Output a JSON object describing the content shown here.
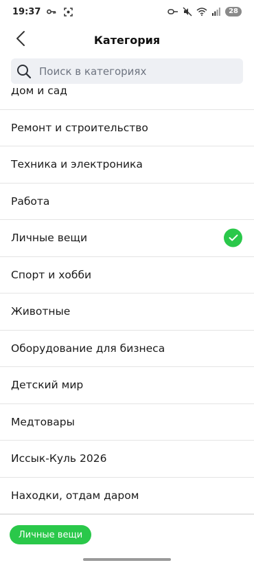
{
  "status_bar": {
    "time": "19:37",
    "battery": "28"
  },
  "header": {
    "title": "Категория"
  },
  "search": {
    "placeholder": "Поиск в категориях",
    "value": ""
  },
  "categories": [
    {
      "label": "Дом и сад",
      "selected": false
    },
    {
      "label": "Ремонт и строительство",
      "selected": false
    },
    {
      "label": "Техника и электроника",
      "selected": false
    },
    {
      "label": "Работа",
      "selected": false
    },
    {
      "label": "Личные вещи",
      "selected": true
    },
    {
      "label": "Спорт и хобби",
      "selected": false
    },
    {
      "label": "Животные",
      "selected": false
    },
    {
      "label": "Оборудование для бизнеса",
      "selected": false
    },
    {
      "label": "Детский мир",
      "selected": false
    },
    {
      "label": "Медтовары",
      "selected": false
    },
    {
      "label": "Иссык-Куль 2026",
      "selected": false
    },
    {
      "label": "Находки, отдам даром",
      "selected": false
    }
  ],
  "selected_chip": {
    "label": "Личные вещи"
  },
  "colors": {
    "accent": "#2ac84a",
    "search_bg": "#eef0f4",
    "divider": "#e4e4e4"
  },
  "icons": {
    "back": "chevron-left-icon",
    "search": "search-icon",
    "check": "check-icon"
  }
}
